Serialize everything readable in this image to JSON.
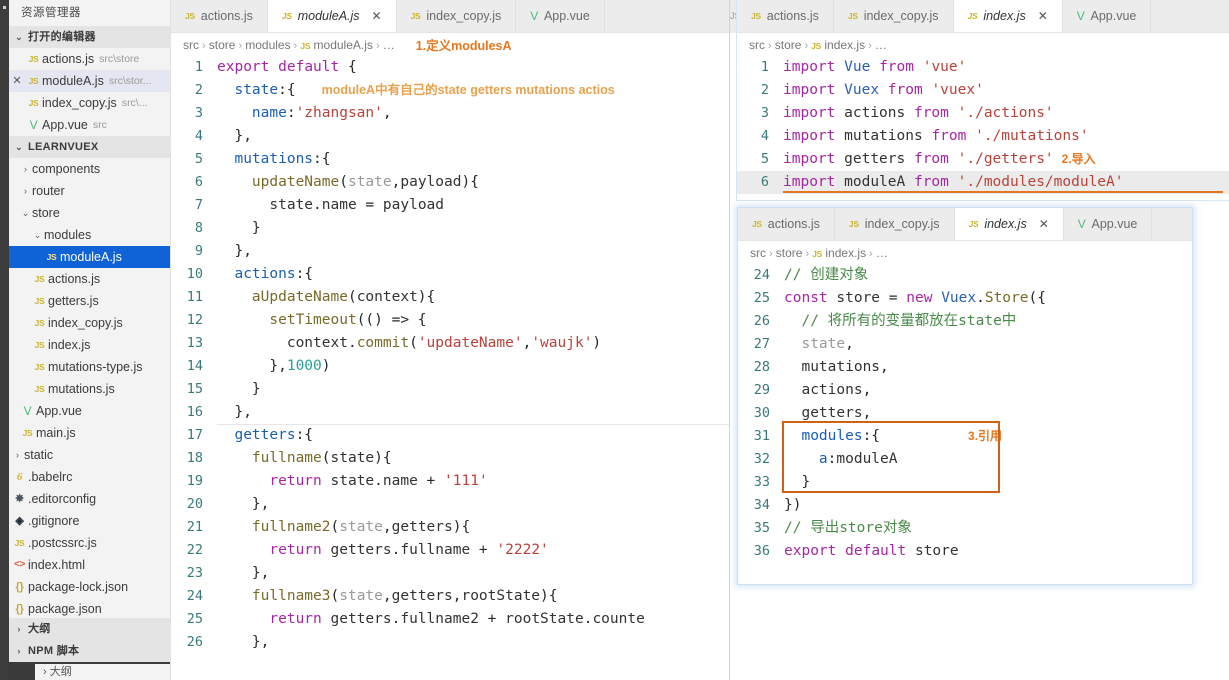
{
  "sidebar": {
    "title": "资源管理器",
    "open_editors": {
      "label": "打开的编辑器",
      "twisty": "⌄",
      "items": [
        {
          "icon": "js-file-icon",
          "icon_text": "JS",
          "name": "actions.js",
          "meta": "src\\store",
          "close": ""
        },
        {
          "icon": "js-file-icon",
          "icon_text": "JS",
          "name": "moduleA.js",
          "meta": "src\\stor...",
          "close": "✕"
        },
        {
          "icon": "js-file-icon",
          "icon_text": "JS",
          "name": "index_copy.js",
          "meta": "src\\...",
          "close": ""
        },
        {
          "icon": "vue-file-icon",
          "icon_text": "V",
          "name": "App.vue",
          "meta": "src",
          "close": ""
        }
      ]
    },
    "project": {
      "label": "LEARNVUEX",
      "twisty": "⌄",
      "tree": [
        {
          "indent": 1,
          "twisty": "›",
          "icon": "folder-icon",
          "icon_text": "",
          "name": "components"
        },
        {
          "indent": 1,
          "twisty": "›",
          "icon": "folder-icon",
          "icon_text": "",
          "name": "router"
        },
        {
          "indent": 1,
          "twisty": "⌄",
          "icon": "folder-icon",
          "icon_text": "",
          "name": "store"
        },
        {
          "indent": 2,
          "twisty": "⌄",
          "icon": "folder-icon",
          "icon_text": "",
          "name": "modules"
        },
        {
          "indent": 3,
          "twisty": "",
          "icon": "js-file-icon",
          "icon_text": "JS",
          "name": "moduleA.js",
          "selected": true
        },
        {
          "indent": 2,
          "twisty": "",
          "icon": "js-file-icon",
          "icon_text": "JS",
          "name": "actions.js"
        },
        {
          "indent": 2,
          "twisty": "",
          "icon": "js-file-icon",
          "icon_text": "JS",
          "name": "getters.js"
        },
        {
          "indent": 2,
          "twisty": "",
          "icon": "js-file-icon",
          "icon_text": "JS",
          "name": "index_copy.js"
        },
        {
          "indent": 2,
          "twisty": "",
          "icon": "js-file-icon",
          "icon_text": "JS",
          "name": "index.js"
        },
        {
          "indent": 2,
          "twisty": "",
          "icon": "js-file-icon",
          "icon_text": "JS",
          "name": "mutations-type.js"
        },
        {
          "indent": 2,
          "twisty": "",
          "icon": "js-file-icon",
          "icon_text": "JS",
          "name": "mutations.js"
        },
        {
          "indent": 1,
          "twisty": "",
          "icon": "vue-file-icon",
          "icon_text": "V",
          "name": "App.vue"
        },
        {
          "indent": 1,
          "twisty": "",
          "icon": "js-file-icon",
          "icon_text": "JS",
          "name": "main.js"
        },
        {
          "indent": 0,
          "twisty": "›",
          "icon": "folder-icon",
          "icon_text": "",
          "name": "static"
        },
        {
          "indent": 0,
          "twisty": "",
          "icon": "babel-icon",
          "icon_text": "6",
          "name": ".babelrc"
        },
        {
          "indent": 0,
          "twisty": "",
          "icon": "gear-icon",
          "icon_text": "✸",
          "name": ".editorconfig"
        },
        {
          "indent": 0,
          "twisty": "",
          "icon": "git-icon",
          "icon_text": "◈",
          "name": ".gitignore"
        },
        {
          "indent": 0,
          "twisty": "",
          "icon": "js-file-icon",
          "icon_text": "JS",
          "name": ".postcssrc.js"
        },
        {
          "indent": 0,
          "twisty": "",
          "icon": "html-icon",
          "icon_text": "<>",
          "name": "index.html"
        },
        {
          "indent": 0,
          "twisty": "",
          "icon": "json-icon",
          "icon_text": "{}",
          "name": "package-lock.json"
        },
        {
          "indent": 0,
          "twisty": "",
          "icon": "json-icon",
          "icon_text": "{}",
          "name": "package.json"
        }
      ]
    },
    "collapsed_sections": [
      {
        "twisty": "›",
        "label": "大纲"
      },
      {
        "twisty": "›",
        "label": "NPM 脚本"
      }
    ],
    "peek_label": "› 大纲"
  },
  "left_editor": {
    "tabs": [
      {
        "icon": "js-file-icon",
        "icon_text": "JS",
        "label": "actions.js",
        "active": false,
        "close": ""
      },
      {
        "icon": "js-file-icon",
        "icon_text": "JS",
        "label": "moduleA.js",
        "active": true,
        "close": "✕"
      },
      {
        "icon": "js-file-icon",
        "icon_text": "JS",
        "label": "index_copy.js",
        "active": false,
        "close": ""
      },
      {
        "icon": "vue-file-icon",
        "icon_text": "V",
        "label": "App.vue",
        "active": false,
        "close": ""
      }
    ],
    "breadcrumb": [
      "src",
      "store",
      "modules",
      "moduleA.js",
      "…"
    ],
    "breadcrumb_file_icon": "JS",
    "annotation": "1.定义modulesA",
    "inline_comment": "moduleA中有自己的state getters mutations actios",
    "lines": [
      {
        "n": 1,
        "raw": "export default {"
      },
      {
        "n": 2,
        "raw": "  state:{"
      },
      {
        "n": 3,
        "raw": "    name:'zhangsan',"
      },
      {
        "n": 4,
        "raw": "  },"
      },
      {
        "n": 5,
        "raw": "  mutations:{"
      },
      {
        "n": 6,
        "raw": "    updateName(state,payload){"
      },
      {
        "n": 7,
        "raw": "      state.name = payload"
      },
      {
        "n": 8,
        "raw": "    }"
      },
      {
        "n": 9,
        "raw": "  },"
      },
      {
        "n": 10,
        "raw": "  actions:{"
      },
      {
        "n": 11,
        "raw": "    aUpdateName(context){"
      },
      {
        "n": 12,
        "raw": "      setTimeout(() => {"
      },
      {
        "n": 13,
        "raw": "        context.commit('updateName','waujk')"
      },
      {
        "n": 14,
        "raw": "      },1000)"
      },
      {
        "n": 15,
        "raw": "    }"
      },
      {
        "n": 16,
        "raw": "  },"
      },
      {
        "n": 17,
        "raw": "  getters:{"
      },
      {
        "n": 18,
        "raw": "    fullname(state){"
      },
      {
        "n": 19,
        "raw": "      return state.name + '111'"
      },
      {
        "n": 20,
        "raw": "    },"
      },
      {
        "n": 21,
        "raw": "    fullname2(state,getters){"
      },
      {
        "n": 22,
        "raw": "      return getters.fullname + '2222'"
      },
      {
        "n": 23,
        "raw": "    },"
      },
      {
        "n": 24,
        "raw": "    fullname3(state,getters,rootState){"
      },
      {
        "n": 25,
        "raw": "      return getters.fullname2 + rootState.counte"
      },
      {
        "n": 26,
        "raw": "    },"
      }
    ]
  },
  "top_right_editor": {
    "tabs": [
      {
        "icon": "js-file-icon",
        "icon_text": "JS",
        "label": "actions.js",
        "active": false,
        "close": ""
      },
      {
        "icon": "js-file-icon",
        "icon_text": "JS",
        "label": "index_copy.js",
        "active": false,
        "close": ""
      },
      {
        "icon": "js-file-icon",
        "icon_text": "JS",
        "label": "index.js",
        "active": true,
        "close": "✕"
      },
      {
        "icon": "vue-file-icon",
        "icon_text": "V",
        "label": "App.vue",
        "active": false,
        "close": ""
      }
    ],
    "breadcrumb": [
      "src",
      "store",
      "index.js",
      "…"
    ],
    "breadcrumb_file_icon": "JS",
    "annotation": "2.导入",
    "lines": [
      {
        "n": 1,
        "raw": "import Vue from 'vue'"
      },
      {
        "n": 2,
        "raw": "import Vuex from 'vuex'"
      },
      {
        "n": 3,
        "raw": "import actions from './actions'"
      },
      {
        "n": 4,
        "raw": "import mutations from './mutations'"
      },
      {
        "n": 5,
        "raw": "import getters from './getters'"
      },
      {
        "n": 6,
        "raw": "import moduleA from './modules/moduleA'",
        "highlighted": true,
        "underlined": true
      }
    ]
  },
  "bottom_right_editor": {
    "tabs": [
      {
        "icon": "js-file-icon",
        "icon_text": "JS",
        "label": "actions.js",
        "active": false,
        "close": ""
      },
      {
        "icon": "js-file-icon",
        "icon_text": "JS",
        "label": "index_copy.js",
        "active": false,
        "close": ""
      },
      {
        "icon": "js-file-icon",
        "icon_text": "JS",
        "label": "index.js",
        "active": true,
        "close": "✕"
      },
      {
        "icon": "vue-file-icon",
        "icon_text": "V",
        "label": "App.vue",
        "active": false,
        "close": ""
      }
    ],
    "breadcrumb": [
      "src",
      "store",
      "index.js",
      "…"
    ],
    "breadcrumb_file_icon": "JS",
    "annotation": "3.引用",
    "lines": [
      {
        "n": 24,
        "raw": "// 创建对象"
      },
      {
        "n": 25,
        "raw": "const store = new Vuex.Store({"
      },
      {
        "n": 26,
        "raw": "  // 将所有的变量都放在state中"
      },
      {
        "n": 27,
        "raw": "  state,"
      },
      {
        "n": 28,
        "raw": "  mutations,"
      },
      {
        "n": 29,
        "raw": "  actions,"
      },
      {
        "n": 30,
        "raw": "  getters,"
      },
      {
        "n": 31,
        "raw": "  modules:{"
      },
      {
        "n": 32,
        "raw": "    a:moduleA"
      },
      {
        "n": 33,
        "raw": "  }"
      },
      {
        "n": 34,
        "raw": "})"
      },
      {
        "n": 35,
        "raw": "// 导出store对象"
      },
      {
        "n": 36,
        "raw": "export default store"
      }
    ]
  },
  "colors": {
    "accent_orange": "#e8761d",
    "annotation_box": "#d2601a",
    "selection_blue": "#0f63d6",
    "sidebar_bg": "#f3f3f3",
    "tabbar_bg": "#ececec",
    "editor_bg": "#ffffff",
    "linenum": "#3a7a7a",
    "keyword_purple": "#a626a4",
    "string_red": "#b9423a",
    "comment_green": "#4a8a4a",
    "number_teal": "#2aa198"
  }
}
